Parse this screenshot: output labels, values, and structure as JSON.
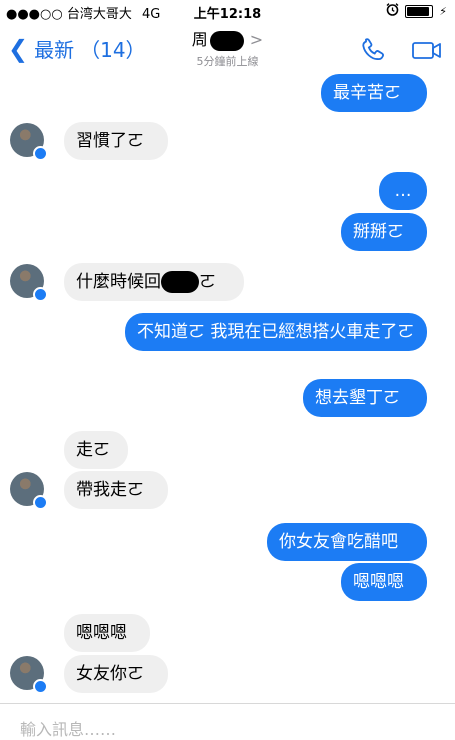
{
  "status_bar": {
    "carrier": "●●●○○ 台湾大哥大",
    "network": "4G",
    "time": "上午12:18",
    "battery_percent": 90
  },
  "nav": {
    "back_label": "最新",
    "back_count": "（14）",
    "contact_name": "周",
    "arrow": ">",
    "last_online": "5分鐘前上線"
  },
  "messages": [
    {
      "side": "out",
      "text": "最辛苦ㄛ"
    },
    {
      "side": "in",
      "text": "習慣了ㄛ"
    },
    {
      "side": "out",
      "text": "…"
    },
    {
      "side": "out",
      "text": "掰掰ㄛ"
    },
    {
      "side": "in",
      "text_before": "什麼時候回",
      "text_after": "ㄛ"
    },
    {
      "side": "out",
      "text": "不知道ㄛ 我現在已經想搭火車走了ㄛ"
    },
    {
      "side": "out",
      "text": "想去墾丁ㄛ"
    },
    {
      "side": "in",
      "text": "走ㄛ"
    },
    {
      "side": "in",
      "text": "帶我走ㄛ"
    },
    {
      "side": "out",
      "text": "你女友會吃醋吧"
    },
    {
      "side": "out",
      "text": "嗯嗯嗯"
    },
    {
      "side": "in",
      "text": "嗯嗯嗯"
    },
    {
      "side": "in",
      "text": "女友你ㄛ"
    }
  ],
  "composer": {
    "placeholder": "輸入訊息……"
  },
  "colors": {
    "accent": "#1e6fe0",
    "outgoing_bubble": "#1c7cf4",
    "incoming_bubble": "#efefef"
  },
  "icons": [
    "phone-icon",
    "video-camera-icon",
    "alarm-clock-icon",
    "battery-icon",
    "messenger-badge-icon"
  ]
}
